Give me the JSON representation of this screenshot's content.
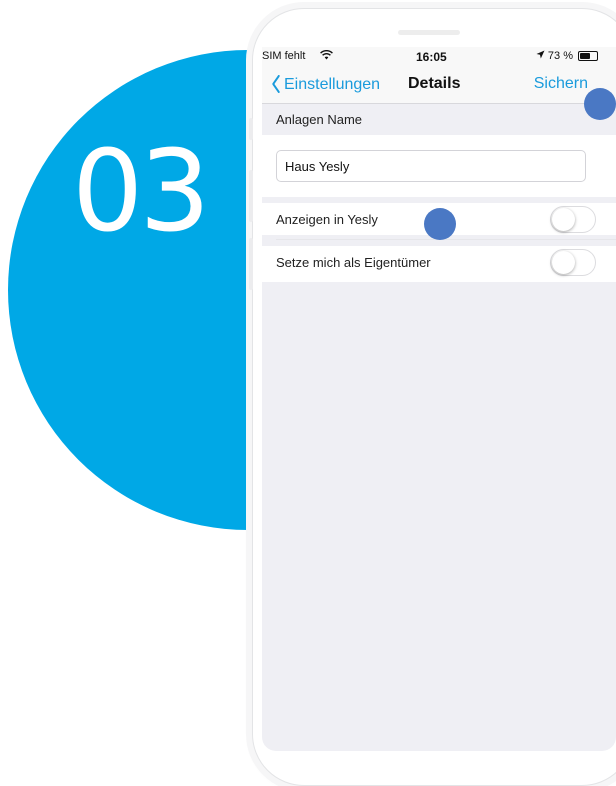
{
  "step": {
    "number": "03"
  },
  "status_bar": {
    "carrier": "SIM fehlt",
    "wifi_icon": "wifi-icon",
    "time": "16:05",
    "location_icon": "location-arrow-icon",
    "battery_percent": "73 %",
    "battery_level": 0.73
  },
  "nav": {
    "back_label": "Einstellungen",
    "title": "Details",
    "save_label": "Sichern"
  },
  "section": {
    "header": "Anlagen Name"
  },
  "name_field": {
    "value": "Haus Yesly"
  },
  "toggles": [
    {
      "label": "Anzeigen in Yesly",
      "on": false
    },
    {
      "label": "Setze mich als Eigentümer",
      "on": false
    }
  ],
  "colors": {
    "accent": "#1a9bdc",
    "step_circle": "#00a8e6",
    "touch_hint": "#4a78c4",
    "screen_background": "#efeff4"
  }
}
